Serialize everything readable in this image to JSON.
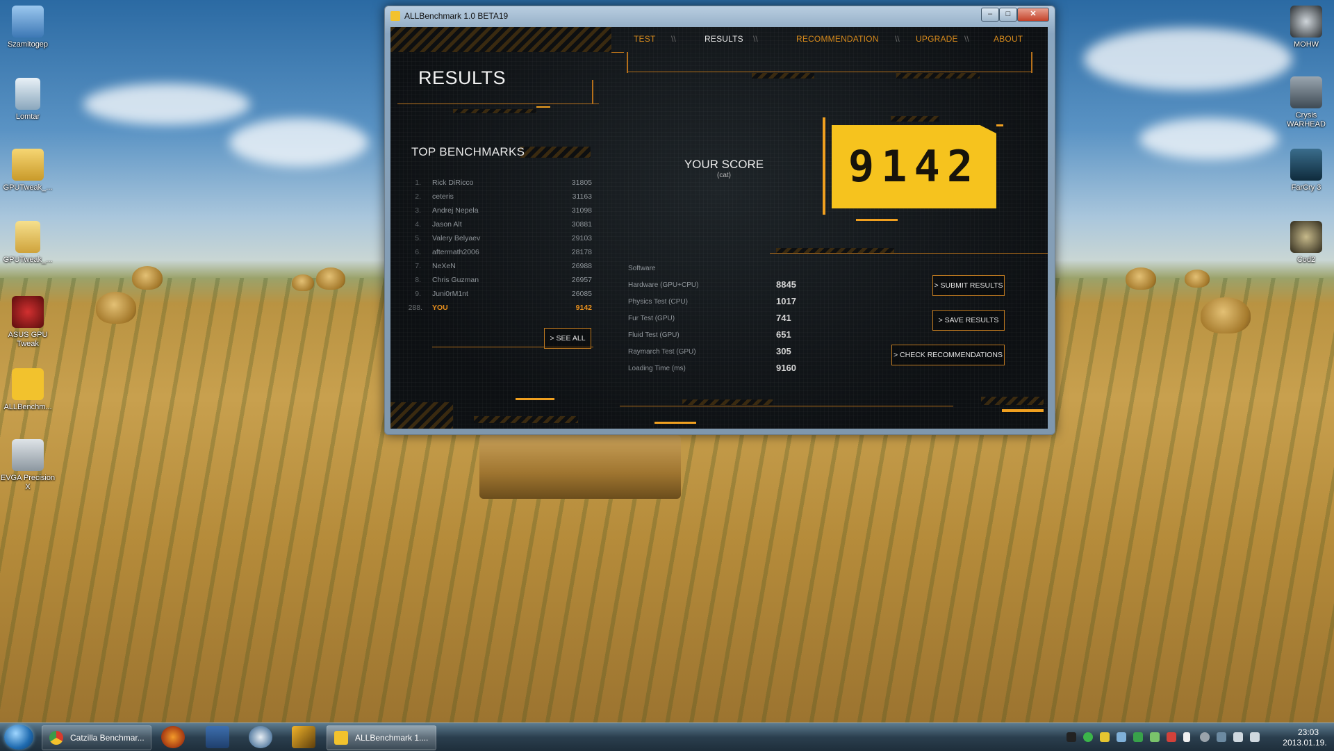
{
  "desktop": {
    "icons_left": [
      {
        "label": "Szamitogep",
        "icon": "computer-icon"
      },
      {
        "label": "Lomtar",
        "icon": "recycle-bin-icon"
      },
      {
        "label": "GPUTweak_...",
        "icon": "zip-folder-icon"
      },
      {
        "label": "GPUTweak_...",
        "icon": "folder-icon"
      },
      {
        "label": "ASUS GPU Tweak",
        "icon": "asus-gpu-tweak-icon"
      },
      {
        "label": "ALLBenchm...",
        "icon": "allbenchmark-icon"
      },
      {
        "label": "EVGA Precision X",
        "icon": "evga-precision-icon"
      }
    ],
    "icons_right": [
      {
        "label": "MOHW",
        "icon": "mohw-icon"
      },
      {
        "label": "Crysis WARHEAD",
        "icon": "crysis-icon"
      },
      {
        "label": "FarCry 3",
        "icon": "farcry-icon"
      },
      {
        "label": "Cod2",
        "icon": "cod2-icon"
      }
    ]
  },
  "window": {
    "title": "ALLBenchmark 1.0 BETA19",
    "controls": {
      "minimize": "–",
      "maximize": "□",
      "close": "✕"
    }
  },
  "app": {
    "nav": [
      {
        "label": "TEST",
        "active": false
      },
      {
        "label": "RESULTS",
        "active": true
      },
      {
        "label": "RECOMMENDATION",
        "active": false
      },
      {
        "label": "UPGRADE",
        "active": false
      },
      {
        "label": "ABOUT",
        "active": false
      }
    ],
    "nav_separator": "\\\\",
    "page_title": "RESULTS",
    "top_benchmarks_title": "TOP BENCHMARKS",
    "leaderboard": [
      {
        "rank": "1.",
        "name": "Rick DiRicco",
        "score": "31805"
      },
      {
        "rank": "2.",
        "name": "ceteris",
        "score": "31163"
      },
      {
        "rank": "3.",
        "name": "Andrej Nepela",
        "score": "31098"
      },
      {
        "rank": "4.",
        "name": "Jason Alt",
        "score": "30881"
      },
      {
        "rank": "5.",
        "name": "Valery Belyaev",
        "score": "29103"
      },
      {
        "rank": "6.",
        "name": "aftermath2006",
        "score": "28178"
      },
      {
        "rank": "7.",
        "name": "NeXeN",
        "score": "26988"
      },
      {
        "rank": "8.",
        "name": "Chris Guzman",
        "score": "26957"
      },
      {
        "rank": "9.",
        "name": "Juni0rM1nt",
        "score": "26085"
      }
    ],
    "you_row": {
      "rank": "288.",
      "name": "YOU",
      "score": "9142"
    },
    "see_all_button": "> SEE ALL",
    "your_score_label": "YOUR SCORE",
    "your_score_sub": "(cat)",
    "score": "9142",
    "results": [
      {
        "label": "Software",
        "value": ""
      },
      {
        "label": "Hardware (GPU+CPU)",
        "value": "8845"
      },
      {
        "label": "Physics Test (CPU)",
        "value": "1017"
      },
      {
        "label": "Fur Test (GPU)",
        "value": "741"
      },
      {
        "label": "Fluid Test (GPU)",
        "value": "651"
      },
      {
        "label": "Raymarch Test (GPU)",
        "value": "305"
      },
      {
        "label": "Loading Time (ms)",
        "value": "9160"
      }
    ],
    "buttons": {
      "submit": "> SUBMIT RESULTS",
      "save": "> SAVE RESULTS",
      "check": "> CHECK RECOMMENDATIONS"
    },
    "colors": {
      "accent": "#d68a1c",
      "score_bg": "#f6c31e"
    }
  },
  "taskbar": {
    "buttons": [
      {
        "label": "Catzilla Benchmar...",
        "icon": "chrome-icon"
      },
      {
        "label": "ALLBenchmark 1....",
        "icon": "allbenchmark-icon"
      }
    ],
    "pinned": [
      "firefox-icon",
      "save-disk-icon",
      "mail-icon",
      "catzilla-icon"
    ],
    "clock_time": "23:03",
    "clock_date": "2013.01.19."
  }
}
